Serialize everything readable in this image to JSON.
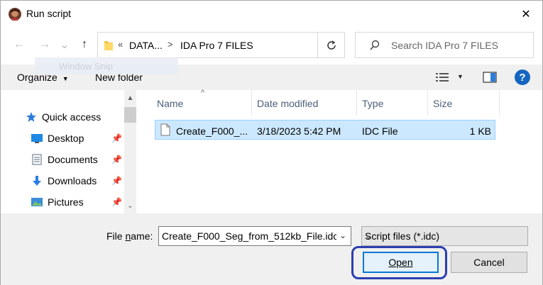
{
  "window": {
    "title": "Run script",
    "close_glyph": "✕"
  },
  "nav": {
    "back_glyph": "←",
    "forward_glyph": "→",
    "recent_glyph": "⌄",
    "up_glyph": "↑"
  },
  "address": {
    "overflow": "«",
    "crumbs": [
      "DATA...",
      "IDA Pro 7 FILES"
    ],
    "separator": ">"
  },
  "search": {
    "placeholder": "Search IDA Pro 7 FILES"
  },
  "toolbar": {
    "organize": "Organize",
    "new_folder": "New folder",
    "help_glyph": "?"
  },
  "ghost_tooltip": {
    "label": "Window Snip"
  },
  "sidebar": {
    "items": [
      {
        "label": "Quick access",
        "icon": "star-icon",
        "color": "#2f7bd6"
      },
      {
        "label": "Desktop",
        "icon": "desktop-icon",
        "color": "#1e88e5",
        "pinned": true
      },
      {
        "label": "Documents",
        "icon": "documents-icon",
        "color": "#5a6b80",
        "pinned": true
      },
      {
        "label": "Downloads",
        "icon": "downloads-icon",
        "color": "#2a7de1",
        "pinned": true
      },
      {
        "label": "Pictures",
        "icon": "pictures-icon",
        "color": "#3a8fd8",
        "pinned": true
      }
    ],
    "pin_glyph": "📌"
  },
  "file_list": {
    "columns": [
      "Name",
      "Date modified",
      "Type",
      "Size"
    ],
    "rows": [
      {
        "name": "Create_F000_...",
        "date": "3/18/2023 5:42 PM",
        "type": "IDC File",
        "size": "1 KB"
      }
    ]
  },
  "footer": {
    "filename_label_pre": "File ",
    "filename_label_u": "n",
    "filename_label_post": "ame:",
    "filename_value": "Create_F000_Seg_from_512kb_File.idc",
    "filter_value": "Script files (*.idc)",
    "open_label": "Open",
    "cancel_label": "Cancel"
  },
  "colors": {
    "accent": "#0078d7",
    "selection": "#cce8ff",
    "annotation": "#2c3fb0"
  }
}
